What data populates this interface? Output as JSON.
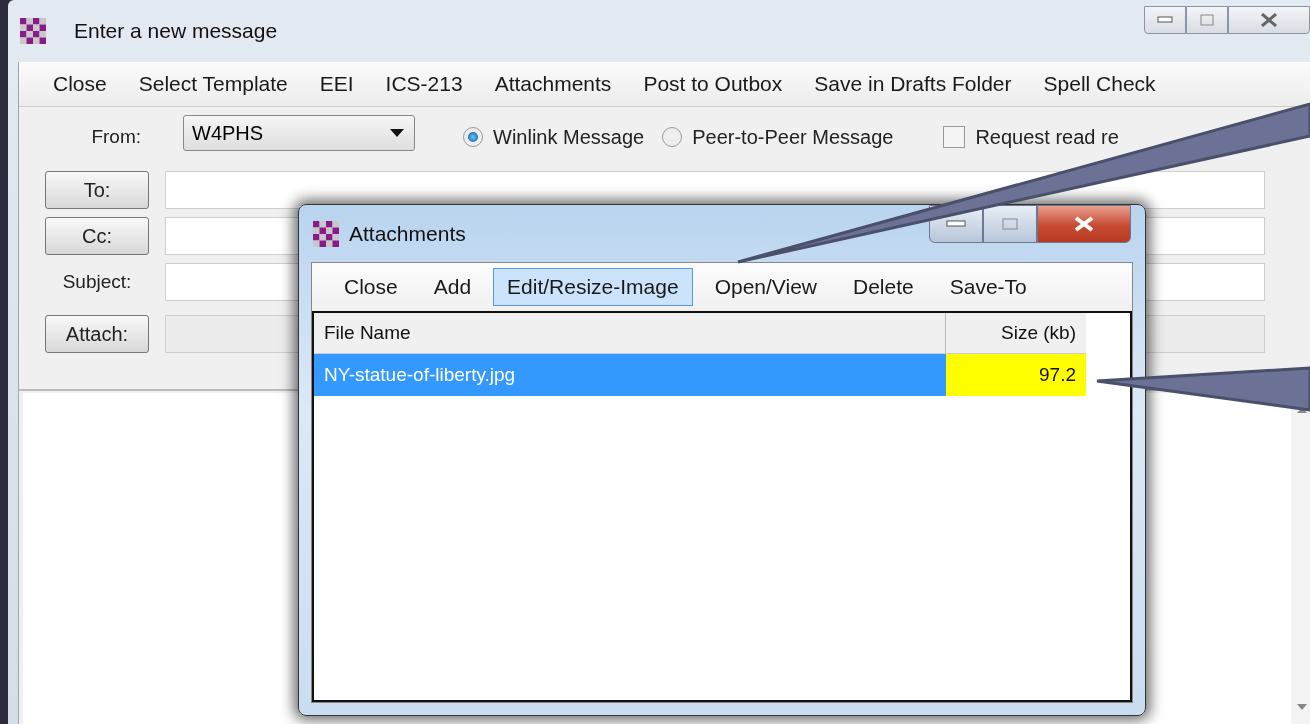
{
  "window": {
    "title": "Enter a new message"
  },
  "menu": [
    "Close",
    "Select Template",
    "EEI",
    "ICS-213",
    "Attachments",
    "Post to Outbox",
    "Save in Drafts Folder",
    "Spell Check"
  ],
  "form": {
    "from_label": "From:",
    "from_value": "W4PHS",
    "message_types": [
      {
        "label": "Winlink Message",
        "selected": true
      },
      {
        "label": "Peer-to-Peer Message",
        "selected": false
      }
    ],
    "read_receipt": {
      "label": "Request read re",
      "checked": false
    },
    "fields": [
      {
        "kind": "button",
        "label": "To:",
        "disabled": false
      },
      {
        "kind": "button",
        "label": "Cc:",
        "disabled": false
      },
      {
        "kind": "label",
        "label": "Subject:",
        "disabled": false
      },
      {
        "kind": "button",
        "label": "Attach:",
        "disabled": true
      }
    ]
  },
  "dialog": {
    "title": "Attachments",
    "menu": [
      {
        "label": "Close",
        "selected": false
      },
      {
        "label": "Add",
        "selected": false
      },
      {
        "label": "Edit/Resize-Image",
        "selected": true
      },
      {
        "label": "Open/View",
        "selected": false
      },
      {
        "label": "Delete",
        "selected": false
      },
      {
        "label": "Save-To",
        "selected": false
      }
    ],
    "columns": [
      "File Name",
      "Size (kb)"
    ],
    "rows": [
      {
        "file_name": "NY-statue-of-liberty.jpg",
        "size": "97.2",
        "selected": true,
        "size_highlighted": true
      }
    ]
  }
}
